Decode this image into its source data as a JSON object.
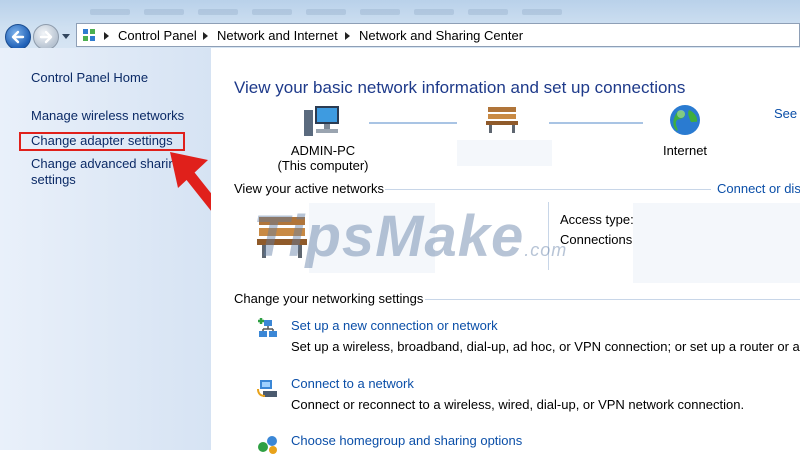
{
  "breadcrumb": {
    "items": [
      "Control Panel",
      "Network and Internet",
      "Network and Sharing Center"
    ]
  },
  "sidebar": {
    "items": [
      {
        "label": "Control Panel Home"
      },
      {
        "label": "Manage wireless networks"
      },
      {
        "label": "Change adapter settings"
      },
      {
        "label": "Change advanced sharing"
      },
      {
        "label": "settings"
      }
    ],
    "highlight_color": "#e0201b"
  },
  "main": {
    "title": "View your basic network information and set up connections",
    "see_full_map": "See f",
    "network_map": {
      "computer_name": "ADMIN-PC",
      "computer_note": "(This computer)",
      "internet": "Internet"
    },
    "active_networks": {
      "header": "View your active networks",
      "connect_link": "Connect or disc",
      "access_type_label": "Access type:",
      "connections_label": "Connections:"
    },
    "settings": {
      "header": "Change your networking settings",
      "tasks": [
        {
          "link": "Set up a new connection or network",
          "desc": "Set up a wireless, broadband, dial-up, ad hoc, or VPN connection; or set up a router or acces",
          "icon": "new-connection-icon"
        },
        {
          "link": "Connect to a network",
          "desc": "Connect or reconnect to a wireless, wired, dial-up, or VPN network connection.",
          "icon": "connect-network-icon"
        },
        {
          "link": "Choose homegroup and sharing options",
          "icon": "homegroup-icon"
        }
      ]
    }
  },
  "watermark": {
    "brand": "TipsMake",
    "suffix": ".com"
  },
  "colors": {
    "link": "#0b4fa8",
    "title": "#1e3a8a",
    "sidebar_link": "#0b2a66",
    "arrow": "#e0201b"
  }
}
